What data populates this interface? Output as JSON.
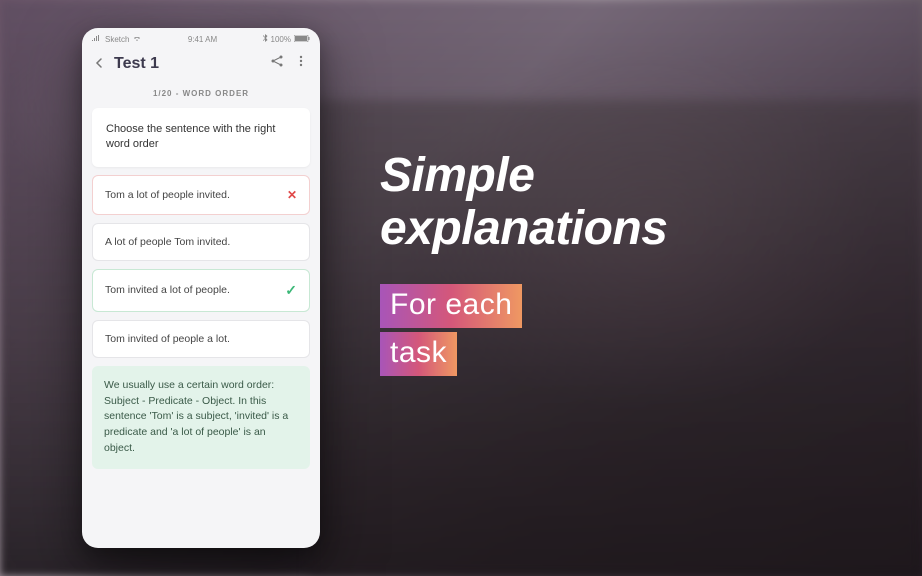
{
  "statusBar": {
    "carrier": "Sketch",
    "time": "9:41 AM",
    "battery": "100%"
  },
  "header": {
    "title": "Test 1"
  },
  "progress": {
    "label": "1/20 - WORD ORDER"
  },
  "question": {
    "text": "Choose the sentence with the right word order"
  },
  "answers": [
    {
      "text": "Tom a lot of people invited.",
      "state": "wrong"
    },
    {
      "text": "A lot of people Tom invited.",
      "state": "neutral"
    },
    {
      "text": "Tom invited a lot of people.",
      "state": "correct"
    },
    {
      "text": "Tom invited of people a lot.",
      "state": "neutral"
    }
  ],
  "explanation": {
    "text": "We usually use a certain word order: Subject - Predicate - Object. In this sentence 'Tom' is a subject, 'invited' is a predicate and 'a lot of people' is an object."
  },
  "marketing": {
    "headline1": "Simple",
    "headline2": "explanations",
    "sub1": "For each",
    "sub2": "task"
  },
  "marks": {
    "wrong": "✕",
    "correct": "✓"
  }
}
